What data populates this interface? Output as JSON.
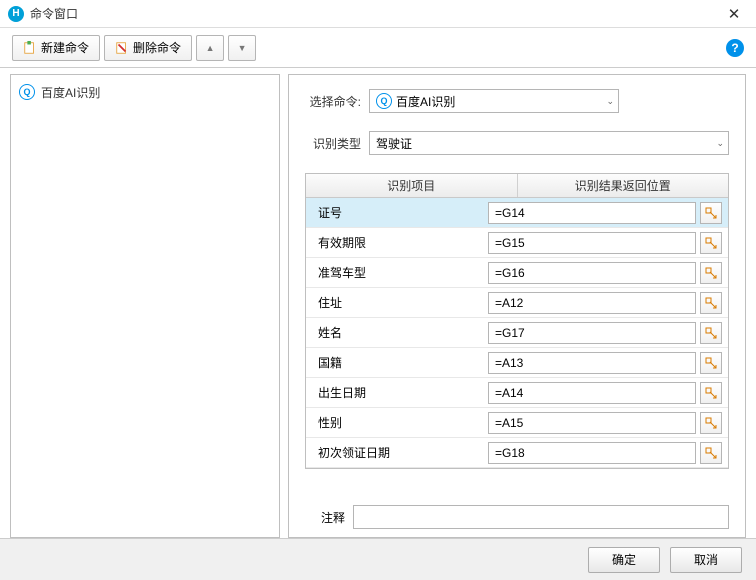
{
  "window": {
    "title": "命令窗口"
  },
  "toolbar": {
    "new_cmd": "新建命令",
    "del_cmd": "删除命令"
  },
  "tree": {
    "items": [
      {
        "label": "百度AI识别"
      }
    ]
  },
  "form": {
    "select_cmd_label": "选择命令:",
    "select_cmd_value": "百度AI识别",
    "type_label": "识别类型",
    "type_value": "驾驶证",
    "comment_label": "注释",
    "comment_value": ""
  },
  "table": {
    "col1": "识别项目",
    "col2": "识别结果返回位置",
    "rows": [
      {
        "item": "证号",
        "pos": "=G14",
        "selected": true
      },
      {
        "item": "有效期限",
        "pos": "=G15",
        "selected": false
      },
      {
        "item": "准驾车型",
        "pos": "=G16",
        "selected": false
      },
      {
        "item": "住址",
        "pos": "=A12",
        "selected": false
      },
      {
        "item": "姓名",
        "pos": "=G17",
        "selected": false
      },
      {
        "item": "国籍",
        "pos": "=A13",
        "selected": false
      },
      {
        "item": "出生日期",
        "pos": "=A14",
        "selected": false
      },
      {
        "item": "性别",
        "pos": "=A15",
        "selected": false
      },
      {
        "item": "初次领证日期",
        "pos": "=G18",
        "selected": false
      }
    ]
  },
  "footer": {
    "ok": "确定",
    "cancel": "取消"
  }
}
